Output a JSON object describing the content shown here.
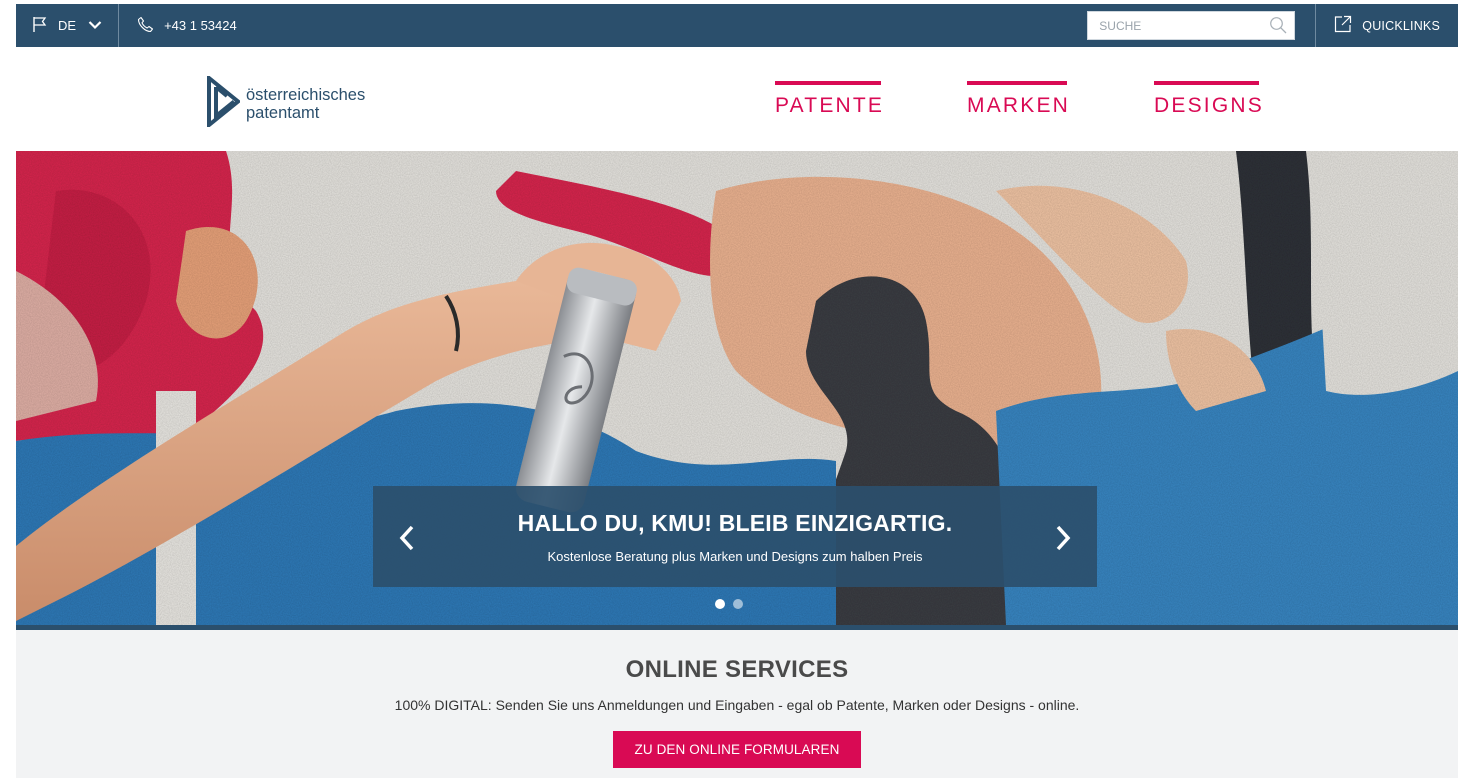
{
  "topbar": {
    "language": "DE",
    "phone": "+43 1 53424",
    "search_placeholder": "SUCHE",
    "quicklinks": "QUICKLINKS"
  },
  "logo": {
    "line1": "österreichisches",
    "line2": "patentamt"
  },
  "nav": [
    {
      "label": "PATENTE"
    },
    {
      "label": "MARKEN"
    },
    {
      "label": "DESIGNS"
    }
  ],
  "hero": {
    "title": "HALLO DU, KMU! BLEIB EINZIGARTIG.",
    "subtitle": "Kostenlose Beratung plus Marken und Designs zum halben Preis",
    "slide_count": 2,
    "active_slide": 1
  },
  "services": {
    "heading": "ONLINE SERVICES",
    "text": "100% DIGITAL: Senden Sie uns Anmeldungen und Eingaben - egal ob Patente, Marken oder Designs - online.",
    "button": "ZU DEN ONLINE FORMULAREN"
  },
  "colors": {
    "primary_blue": "#2b4f6c",
    "accent_magenta": "#d90a54",
    "services_bg": "#f2f3f4"
  }
}
